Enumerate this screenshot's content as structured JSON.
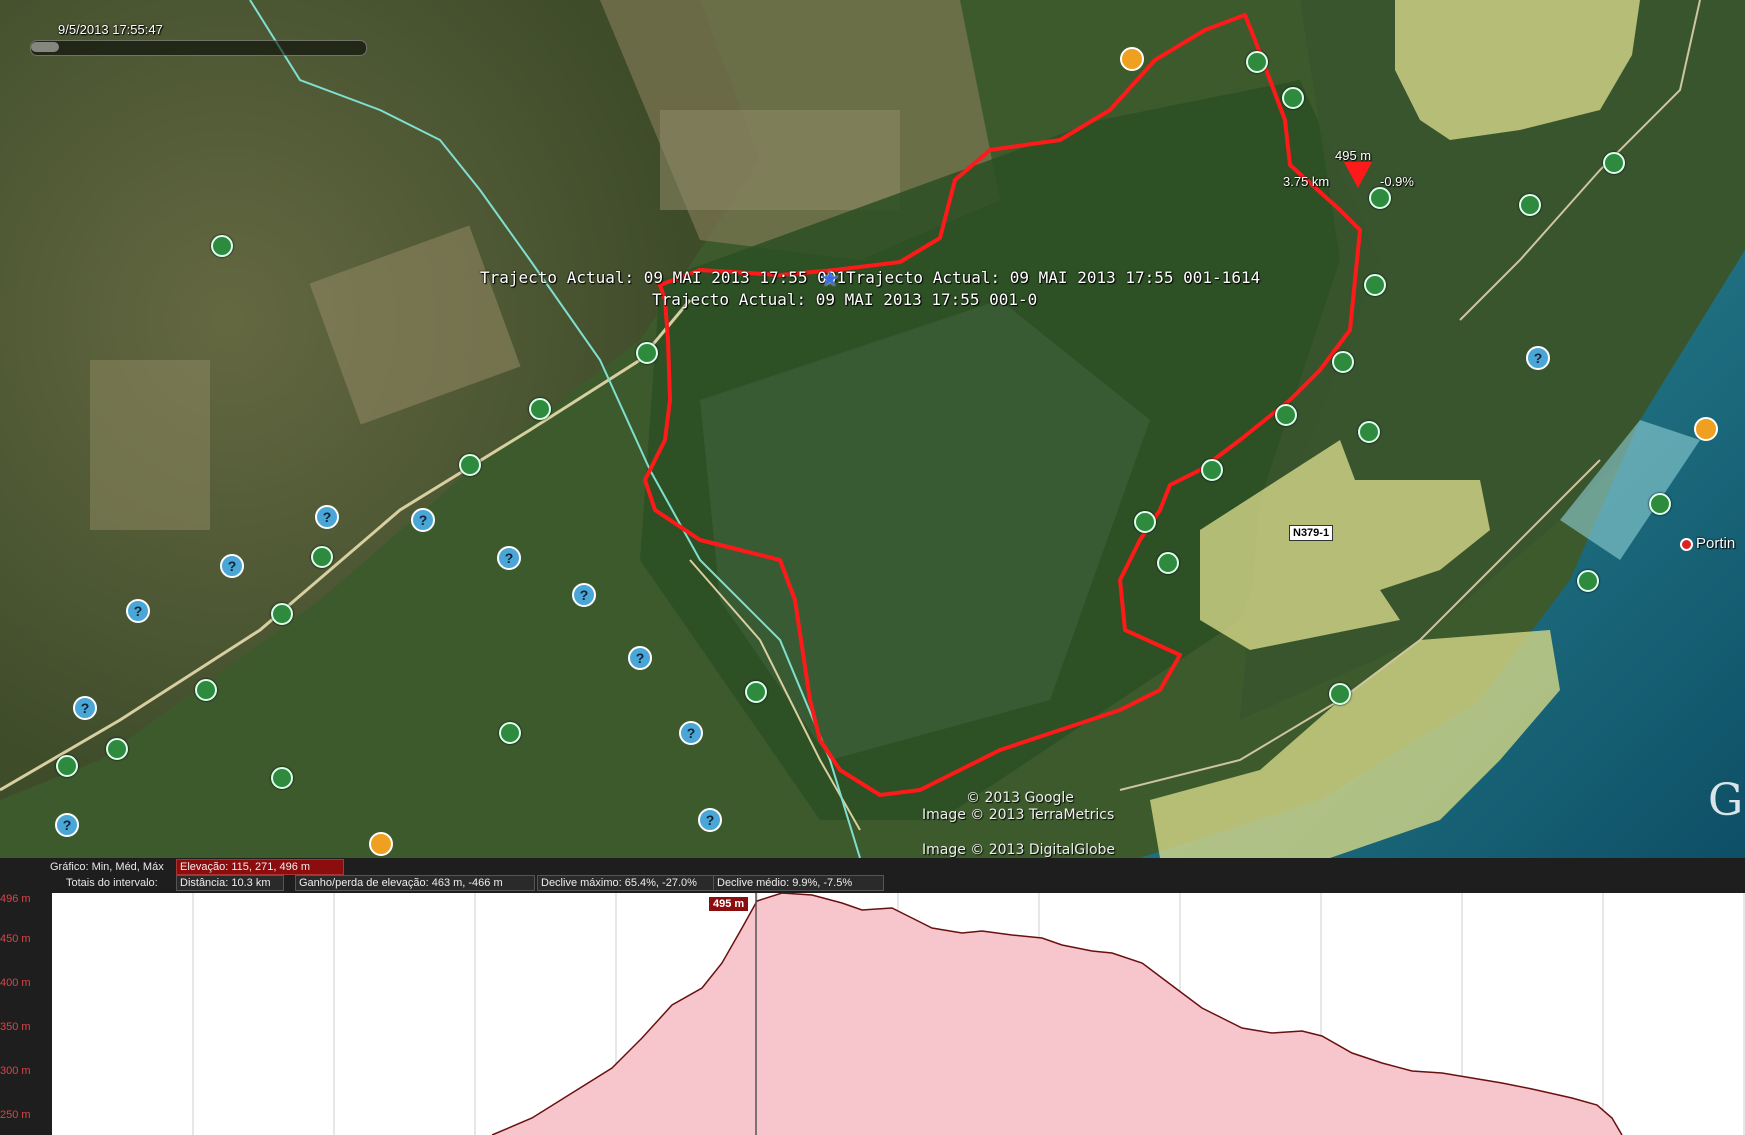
{
  "timestamp": "9/5/2013  17:55:47",
  "track_labels": {
    "label_1": "Trajecto Actual: 09 MAI 2013 17:55 001",
    "label_2": "Trajecto Actual: 09 MAI 2013 17:55 001-1614",
    "label_3": "Trajecto Actual: 09 MAI 2013 17:55 001-0"
  },
  "cursor_info": {
    "elevation": "495 m",
    "distance": "3.75 km",
    "slope": "-0.9%"
  },
  "road_label": "N379-1",
  "place_label": "Portin",
  "copyright": {
    "line_1": "© 2013 Google",
    "line_2": "Image © 2013 TerraMetrics",
    "line_3": "Image © 2013 DigitalGlobe"
  },
  "brand_partial": "G",
  "elevation_profile": {
    "graph_label": "Gráfico: Min, Méd, Máx",
    "elevation_stats": "Elevação: 115, 271, 496 m",
    "range_totals_label": "Totais do intervalo:",
    "distance": "Distância: 10.3 km",
    "gain_loss": "Ganho/perda de elevação: 463 m, -466 m",
    "max_slope": "Declive máximo: 65.4%, -27.0%",
    "avg_slope": "Declive médio: 9.9%, -7.5%",
    "peak_tag": "495 m",
    "y_ticks": [
      "496 m",
      "450 m",
      "400 m",
      "350 m",
      "300 m",
      "250 m"
    ],
    "colors": {
      "fill": "#f6c6cc",
      "line": "#6a1010",
      "tag": "#8b0d0d"
    }
  },
  "markers": {
    "park_icon_color": "#2e8b3e",
    "question_icon_color": "#4aa6d6",
    "route_color": "#ff1a1a"
  }
}
